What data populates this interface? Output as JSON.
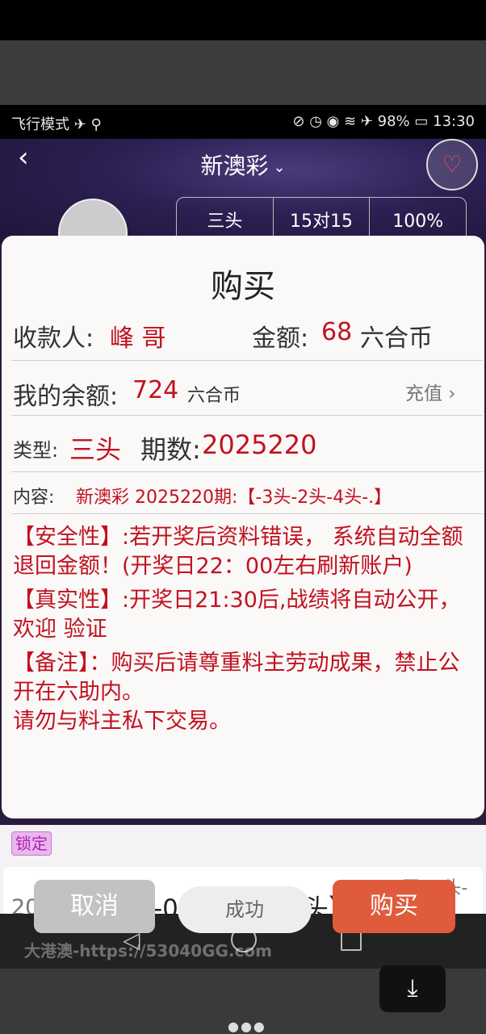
{
  "statusbar": {
    "left": "飞行模式 ✈ ⚲",
    "right": "⊘ ◷ ◉ ≋ ✈ 98%  ▭  13:30"
  },
  "appbar": {
    "back_icon": "chevron-left-icon",
    "title": "新澳彩",
    "title_chevron": "⌄",
    "fav_icon": "heart-icon",
    "stats": [
      "三头",
      "15对15",
      "100%"
    ]
  },
  "dialog": {
    "title": "购买",
    "payee_label": "收款人:",
    "payee_value": "峰 哥",
    "amount_label": "金额:",
    "amount_value": "68",
    "amount_unit": "六合币",
    "balance_label": "我的余额:",
    "balance_value": "724",
    "balance_unit": "六合币",
    "recharge_label": "充值 ›",
    "type_label": "类型:",
    "type_value": "三头",
    "issue_label": "期数:",
    "issue_value": "2025220",
    "content_label": "内容:",
    "content_value": "新澳彩 2025220期:【-3头-2头-4头-.】",
    "notes": [
      "【安全性】:若开奖后资料错误， 系统自动全额退回金额！(开奖日22：00左右刷新账户)",
      "【真实性】:开奖日21:30后,战绩将自动公开，欢迎 验证",
      "【备注】：购买后请尊重料主劳动成果，禁止公开在六助内。\n请勿与料主私下交易。"
    ],
    "cancel_label": "取消",
    "success_label": "成功",
    "buy_label": "购买"
  },
  "list": {
    "locked_tag": "锁定",
    "record_period": "2025217期",
    "record_content": "-0头-2头-【4头】-",
    "record_result": "开:-4头-"
  },
  "overlay": {
    "watermark": "大港澳-https://53040GG.com",
    "download_icon": "download-icon",
    "pager": "●●●"
  }
}
